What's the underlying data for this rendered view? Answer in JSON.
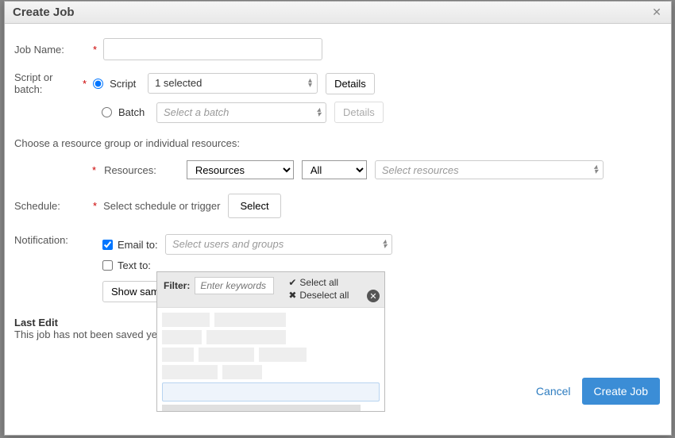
{
  "dialog": {
    "title": "Create Job"
  },
  "labels": {
    "jobName": "Job Name:",
    "scriptOrBatch": "Script or batch:",
    "script": "Script",
    "batch": "Batch",
    "details": "Details",
    "chooseResource": "Choose a resource group or individual resources:",
    "resources": "Resources:",
    "schedule": "Schedule:",
    "scheduleText": "Select schedule or trigger",
    "select": "Select",
    "notification": "Notification:",
    "emailTo": "Email to:",
    "textTo": "Text to:",
    "showSample": "Show sample notification",
    "lastEditTitle": "Last Edit",
    "lastEditText": "This job has not been saved yet.",
    "cancel": "Cancel",
    "createJob": "Create Job"
  },
  "values": {
    "jobName": "",
    "scriptSelected": "1 selected",
    "batchPlaceholder": "Select a batch",
    "resourcesType": "Resources",
    "resourcesScope": "All",
    "selectResourcesPlaceholder": "Select resources",
    "emailPlaceholder": "Select users and groups",
    "emailToChecked": true,
    "textToChecked": false
  },
  "dropdown": {
    "filterLabel": "Filter:",
    "filterPlaceholder": "Enter keywords",
    "selectAll": "Select all",
    "deselectAll": "Deselect all"
  },
  "options": {
    "resourceTypes": [
      "Resources"
    ],
    "scopes": [
      "All"
    ]
  }
}
